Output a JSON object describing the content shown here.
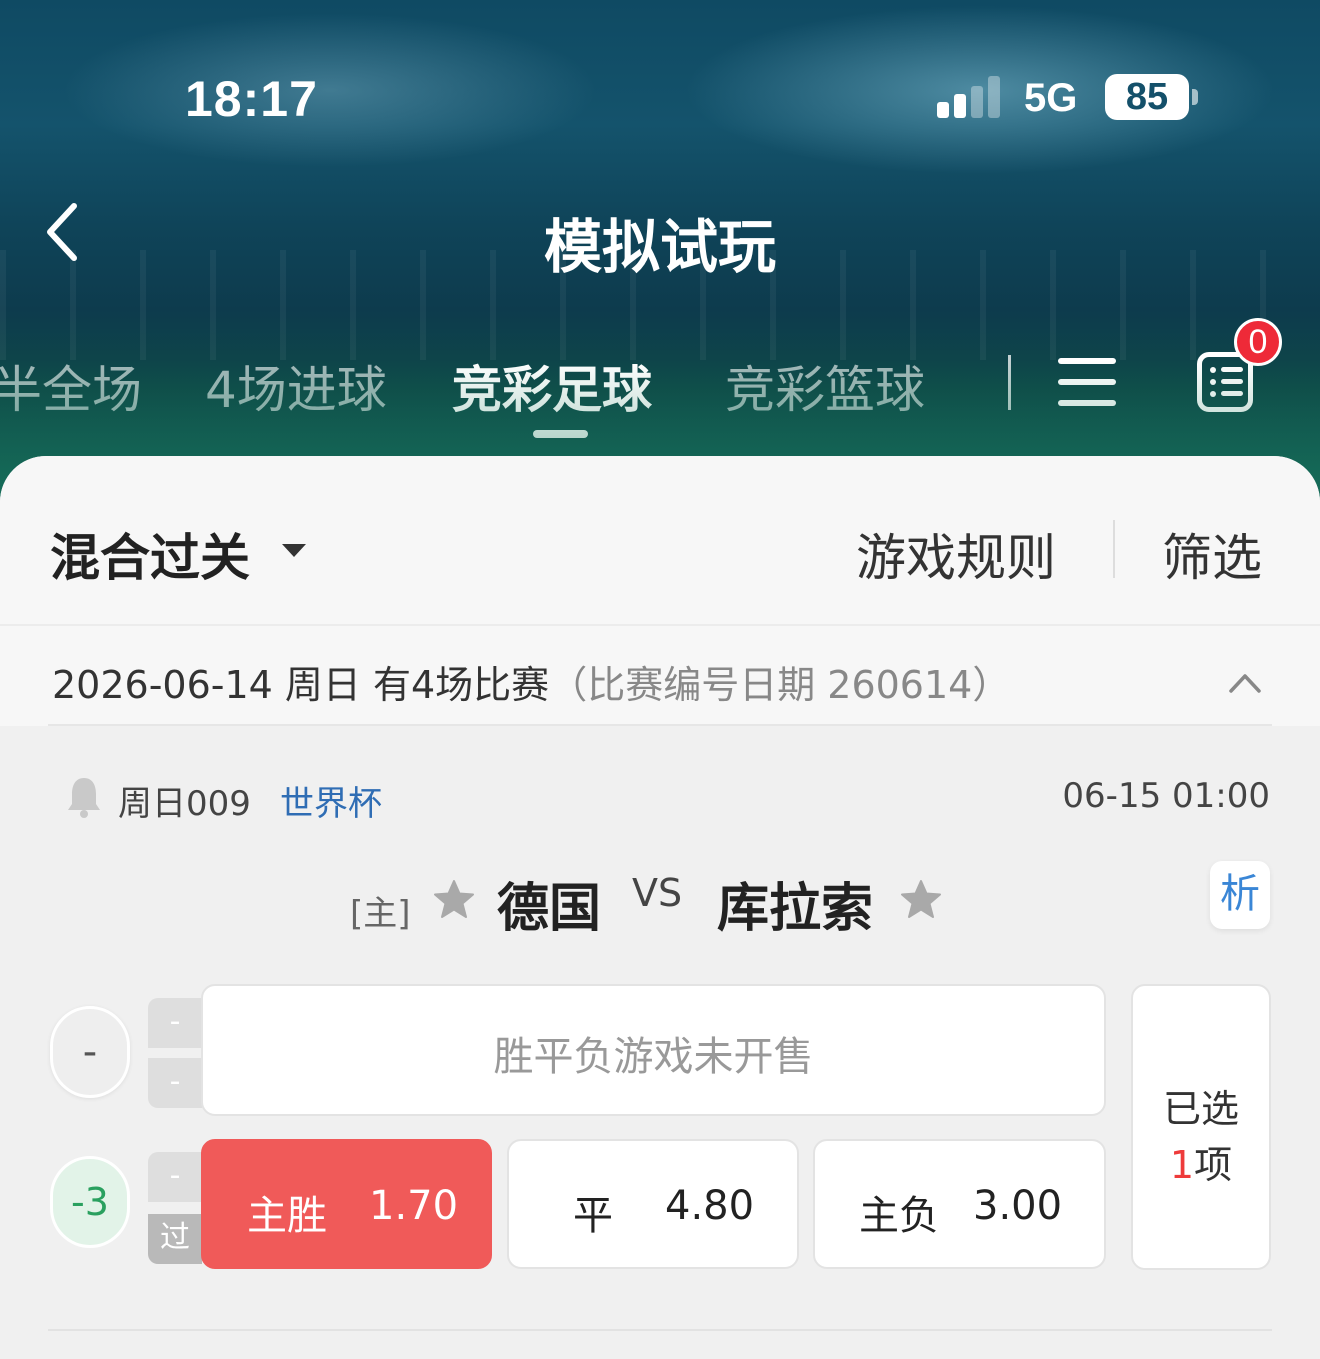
{
  "status_bar": {
    "time": "18:17",
    "network": "5G",
    "battery": "85"
  },
  "header": {
    "title": "模拟试玩"
  },
  "tabs": [
    {
      "label": "半全场"
    },
    {
      "label": "4场进球"
    },
    {
      "label": "竞彩足球"
    },
    {
      "label": "竞彩篮球"
    }
  ],
  "active_tab": "竞彩足球",
  "cart_badge": "0",
  "toolbar": {
    "mode": "混合过关",
    "rules": "游戏规则",
    "filter": "筛选"
  },
  "date_section": {
    "date": "2026-06-14 周日 有4场比赛",
    "note": "（比赛编号日期 260614）"
  },
  "match": {
    "number": "周日009",
    "league": "世界杯",
    "kickoff": "06-15 01:00",
    "home_tag": "[主]",
    "home_team": "德国",
    "vs": "VS",
    "away_team": "库拉索",
    "analysis": "析",
    "row1": {
      "handicap": "-",
      "mini_top": "-",
      "mini_bottom": "-",
      "closed_text": "胜平负游戏未开售"
    },
    "row2": {
      "handicap": "-3",
      "mini_top": "-",
      "mini_bottom": "过",
      "odds": [
        {
          "label": "主胜",
          "value": "1.70",
          "selected": true
        },
        {
          "label": "平",
          "value": "4.80",
          "selected": false
        },
        {
          "label": "主负",
          "value": "3.00",
          "selected": false
        }
      ]
    },
    "selected": {
      "line1": "已选",
      "count": "1",
      "unit": "项"
    }
  },
  "colors": {
    "accent_red": "#f05a59",
    "league_blue": "#2f6db4",
    "handicap_green": "#2aa05f",
    "badge_red": "#ee2a38"
  }
}
